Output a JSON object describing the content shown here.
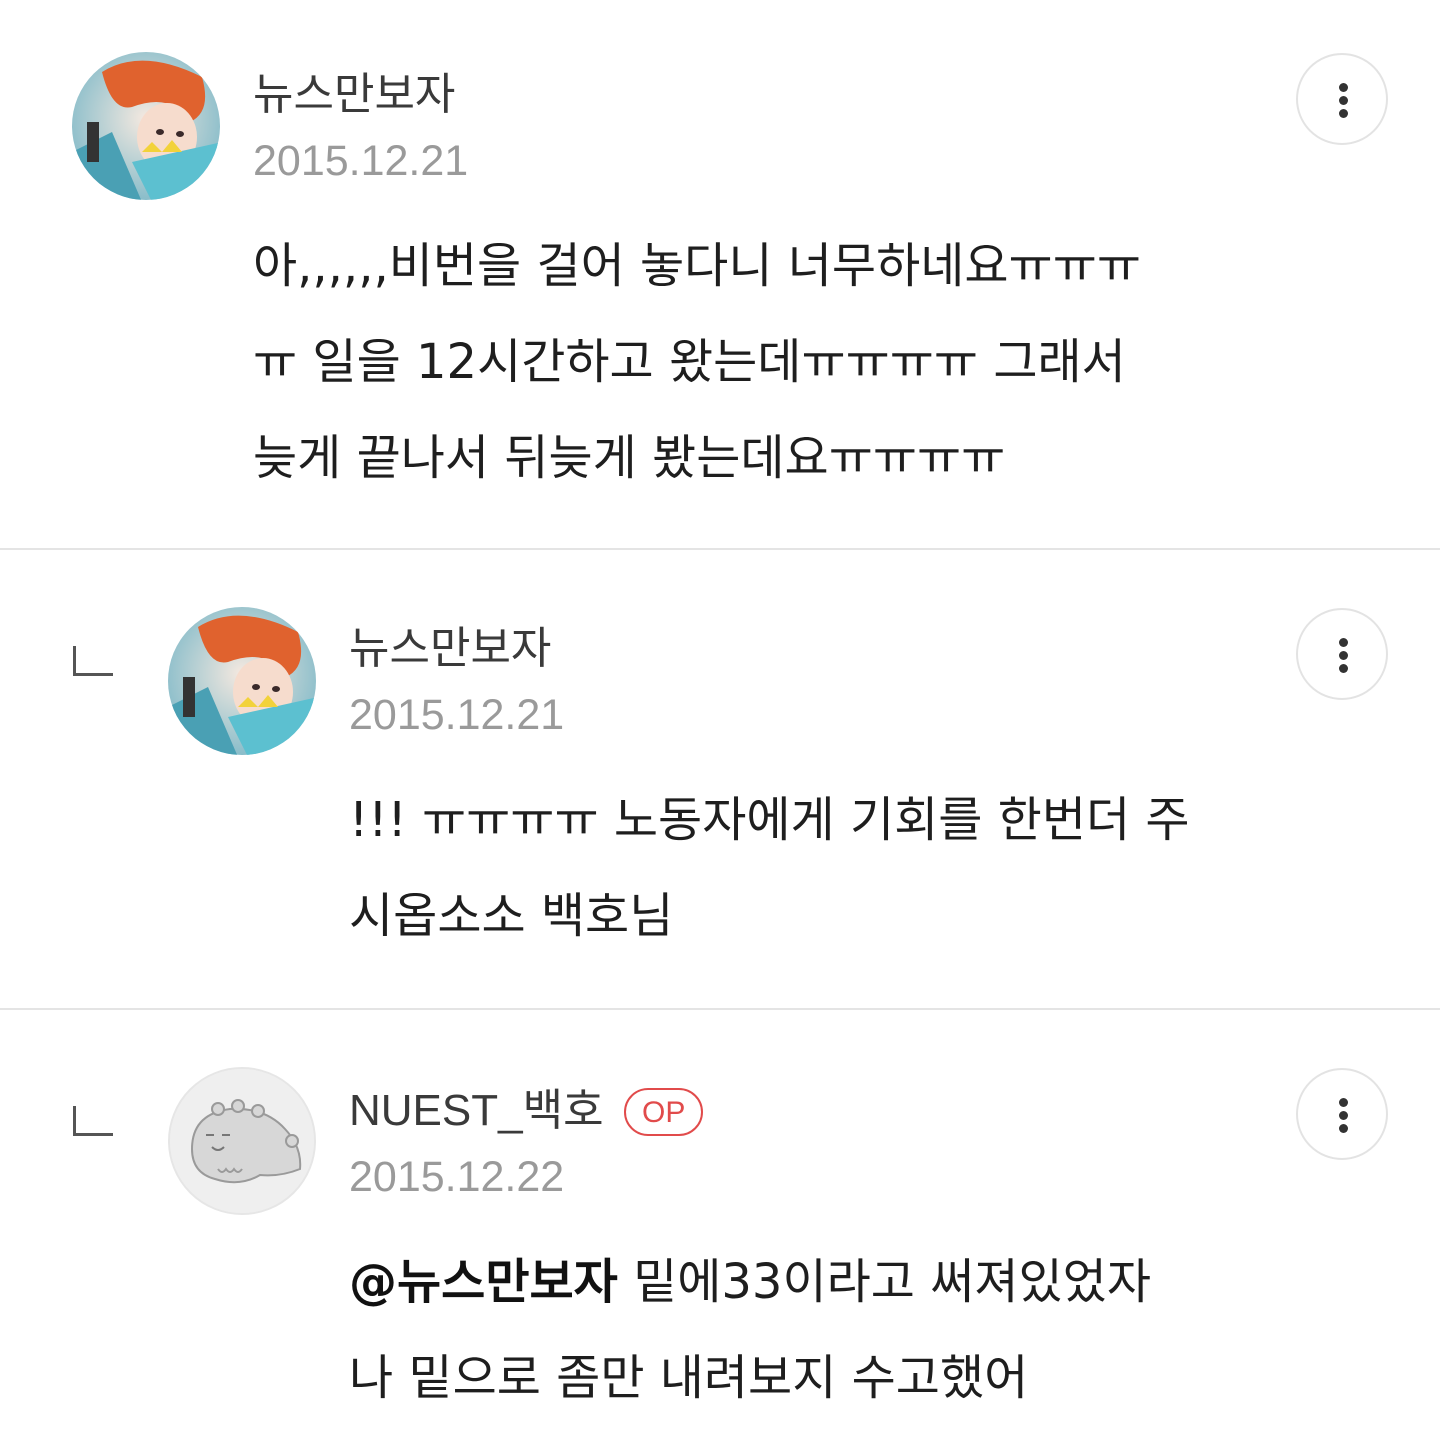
{
  "comments": [
    {
      "username": "뉴스만보자",
      "date": "2015.12.21",
      "lines": [
        "아,,,,,,비번을 걸어 놓다니 너무하네요ㅠㅠㅠ",
        "ㅠ 일을 12시간하고 왔는데ㅠㅠㅠㅠ 그래서",
        "늦게 끝나서 뒤늦게 봤는데요ㅠㅠㅠㅠ"
      ],
      "avatar_icon": "user-photo-avatar"
    },
    {
      "username": "뉴스만보자",
      "date": "2015.12.21",
      "lines": [
        "!!! ㅠㅠㅠㅠ 노동자에게 기회를 한번더 주",
        "시옵소소 백호님"
      ],
      "avatar_icon": "user-photo-avatar"
    },
    {
      "username": "NUEST_백호",
      "badge": "OP",
      "date": "2015.12.22",
      "mention": "@뉴스만보자",
      "lines": [
        " 밑에33이라고 써져있었자",
        "나 밑으로 좀만 내려보지 수고했어"
      ],
      "avatar_icon": "default-creature-avatar"
    }
  ],
  "colors": {
    "badge": "#e14b4b",
    "date": "#9a9a9a",
    "divider": "#e4e4e4"
  },
  "icons": {
    "more": "more-vertical-icon",
    "reply": "reply-arrow-icon"
  }
}
